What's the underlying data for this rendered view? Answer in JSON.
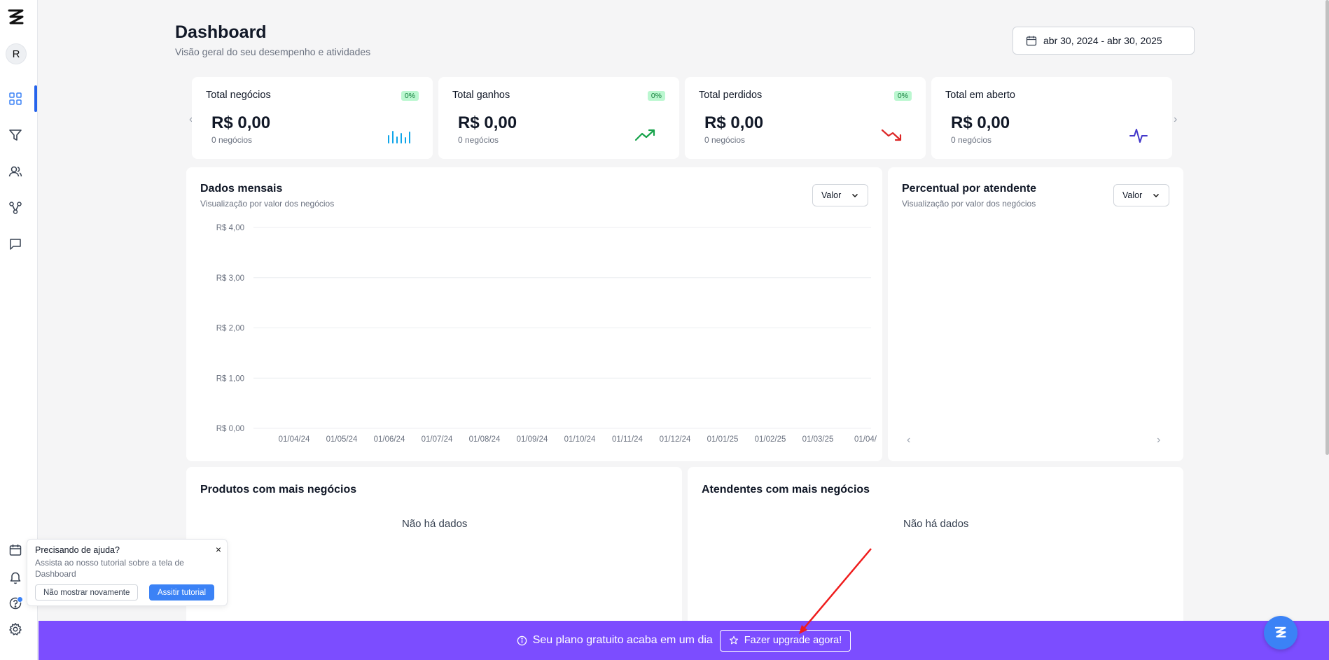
{
  "sidebar": {
    "avatar_initial": "R",
    "items": [
      "dashboard-icon",
      "funnel-icon",
      "users-icon",
      "integrations-icon",
      "chat-icon"
    ],
    "bottom_items": [
      "calendar-icon",
      "bell-icon",
      "help-icon",
      "gear-icon"
    ]
  },
  "header": {
    "title": "Dashboard",
    "subtitle": "Visão geral do seu desempenho e atividades",
    "date_range": "abr 30, 2024 - abr 30, 2025"
  },
  "stats": [
    {
      "label": "Total negócios",
      "badge": "0%",
      "value": "R$ 0,00",
      "sub": "0 negócios",
      "icon": "bar-chart-icon",
      "color": "#0ea5e9"
    },
    {
      "label": "Total ganhos",
      "badge": "0%",
      "value": "R$ 0,00",
      "sub": "0 negócios",
      "icon": "trending-up-icon",
      "color": "#16a34a"
    },
    {
      "label": "Total perdidos",
      "badge": "0%",
      "value": "R$ 0,00",
      "sub": "0 negócios",
      "icon": "trending-down-icon",
      "color": "#dc2626"
    },
    {
      "label": "Total em aberto",
      "badge": "",
      "value": "R$ 0,00",
      "sub": "0 negócios",
      "icon": "activity-icon",
      "color": "#4338ca"
    }
  ],
  "monthly": {
    "title": "Dados mensais",
    "subtitle": "Visualização por valor dos negócios",
    "select": "Valor"
  },
  "attendant_pct": {
    "title": "Percentual por atendente",
    "subtitle": "Visualização por valor dos negócios",
    "select": "Valor"
  },
  "products": {
    "title": "Produtos com mais negócios",
    "empty": "Não há dados"
  },
  "attendants": {
    "title": "Atendentes com mais negócios",
    "empty": "Não há dados"
  },
  "help": {
    "title": "Precisando de ajuda?",
    "text": "Assista ao nosso tutorial sobre a tela de Dashboard",
    "close": "×",
    "dismiss_label": "Não mostrar novamente",
    "watch_label": "Assitir tutorial"
  },
  "banner": {
    "text": "Seu plano gratuito acaba em um dia",
    "button": "Fazer upgrade agora!"
  },
  "chart_data": {
    "type": "line",
    "x": [
      "01/04/24",
      "01/05/24",
      "01/06/24",
      "01/07/24",
      "01/08/24",
      "01/09/24",
      "01/10/24",
      "01/11/24",
      "01/12/24",
      "01/01/25",
      "01/02/25",
      "01/03/25",
      "01/04/"
    ],
    "series": [],
    "y_ticks": [
      "R$ 4,00",
      "R$ 3,00",
      "R$ 2,00",
      "R$ 1,00",
      "R$ 0,00"
    ],
    "ylim": [
      0,
      4
    ],
    "grid": true
  }
}
